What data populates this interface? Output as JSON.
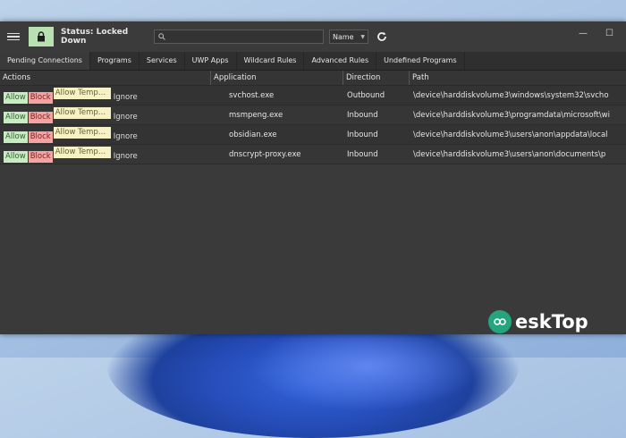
{
  "toolbar": {
    "status_text": "Status: Locked Down",
    "search_placeholder": "",
    "sort_selected": "Name",
    "lock_color": "#b9e0b0"
  },
  "tabs": [
    {
      "label": "Pending Connections"
    },
    {
      "label": "Programs"
    },
    {
      "label": "Services"
    },
    {
      "label": "UWP Apps"
    },
    {
      "label": "Wildcard Rules"
    },
    {
      "label": "Advanced Rules"
    },
    {
      "label": "Undefined Programs"
    }
  ],
  "table": {
    "headers": {
      "actions": "Actions",
      "application": "Application",
      "direction": "Direction",
      "path": "Path"
    },
    "action_labels": {
      "allow": "Allow",
      "block": "Block",
      "allow_temp": "Allow Temp…",
      "ignore": "Ignore"
    },
    "rows": [
      {
        "application": "svchost.exe",
        "direction": "Outbound",
        "path": "\\device\\harddiskvolume3\\windows\\system32\\svcho"
      },
      {
        "application": "msmpeng.exe",
        "direction": "Inbound",
        "path": "\\device\\harddiskvolume3\\programdata\\microsoft\\wi"
      },
      {
        "application": "obsidian.exe",
        "direction": "Inbound",
        "path": "\\device\\harddiskvolume3\\users\\anon\\appdata\\local"
      },
      {
        "application": "dnscrypt-proxy.exe",
        "direction": "Inbound",
        "path": "\\device\\harddiskvolume3\\users\\anon\\documents\\p"
      }
    ]
  },
  "watermark": {
    "text": "eskTop"
  }
}
